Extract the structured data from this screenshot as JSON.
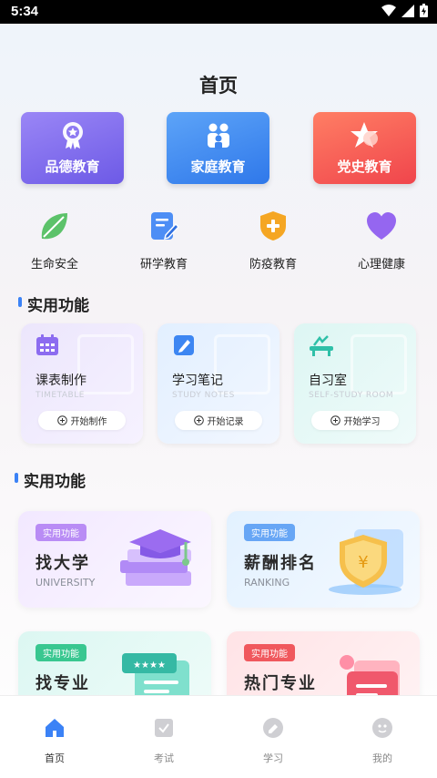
{
  "status_bar": {
    "time": "5:34"
  },
  "header": {
    "title": "首页"
  },
  "big_cards": [
    {
      "label": "品德教育",
      "icon": "medal-icon"
    },
    {
      "label": "家庭教育",
      "icon": "family-icon"
    },
    {
      "label": "党史教育",
      "icon": "star-icon"
    }
  ],
  "small_items": [
    {
      "label": "生命安全",
      "icon": "leaf-icon"
    },
    {
      "label": "研学教育",
      "icon": "edit-doc-icon"
    },
    {
      "label": "防疫教育",
      "icon": "shield-plus-icon"
    },
    {
      "label": "心理健康",
      "icon": "heart-icon"
    }
  ],
  "section1": {
    "title": "实用功能"
  },
  "func_cards": [
    {
      "name": "课表制作",
      "sub": "TIMETABLE",
      "button": "开始制作"
    },
    {
      "name": "学习笔记",
      "sub": "STUDY NOTES",
      "button": "开始记录"
    },
    {
      "name": "自习室",
      "sub": "SELF-STUDY ROOM",
      "button": "开始学习"
    }
  ],
  "section2": {
    "title": "实用功能"
  },
  "promos": [
    {
      "tag": "实用功能",
      "title": "找大学",
      "en": "UNIVERSITY"
    },
    {
      "tag": "实用功能",
      "title": "薪酬排名",
      "en": "RANKING"
    },
    {
      "tag": "实用功能",
      "title": "找专业",
      "en": ""
    },
    {
      "tag": "实用功能",
      "title": "热门专业",
      "en": ""
    }
  ],
  "tabbar": [
    {
      "label": "首页",
      "icon": "home-icon",
      "active": true
    },
    {
      "label": "考试",
      "icon": "exam-icon",
      "active": false
    },
    {
      "label": "学习",
      "icon": "study-icon",
      "active": false
    },
    {
      "label": "我的",
      "icon": "profile-icon",
      "active": false
    }
  ],
  "colors": {
    "accent": "#3b82f6",
    "tag_purple": "#b98cf5",
    "tag_blue": "#67a6f5",
    "tag_green": "#39c790",
    "tag_red": "#f0585d"
  }
}
